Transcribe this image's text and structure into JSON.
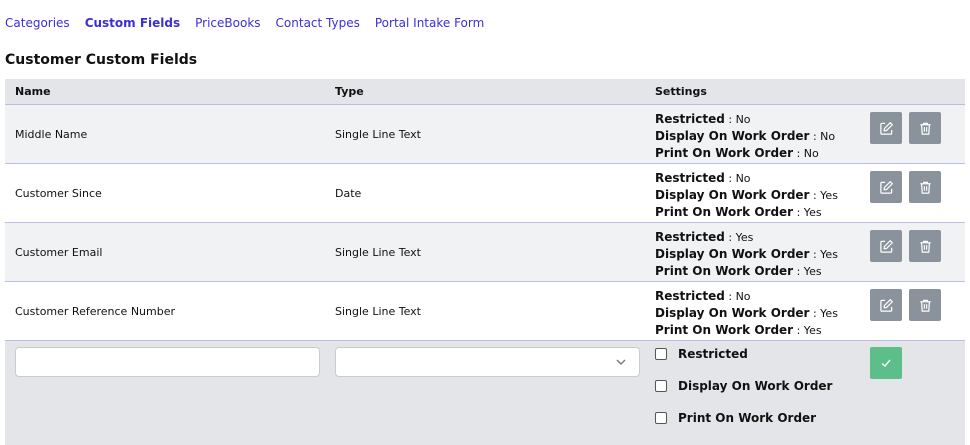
{
  "tabs": [
    {
      "label": "Categories",
      "active": false
    },
    {
      "label": "Custom Fields",
      "active": true
    },
    {
      "label": "PriceBooks",
      "active": false
    },
    {
      "label": "Contact Types",
      "active": false
    },
    {
      "label": "Portal Intake Form",
      "active": false
    }
  ],
  "section_title": "Customer Custom Fields",
  "table": {
    "headers": {
      "name": "Name",
      "type": "Type",
      "settings": "Settings"
    },
    "setting_labels": {
      "restricted": "Restricted",
      "display": "Display On Work Order",
      "print": "Print On Work Order"
    },
    "rows": [
      {
        "name": "Middle Name",
        "type": "Single Line Text",
        "restricted": ": No",
        "display": ": No",
        "print": ": No"
      },
      {
        "name": "Customer Since",
        "type": "Date",
        "restricted": ": No",
        "display": ": Yes",
        "print": ": Yes"
      },
      {
        "name": "Customer Email",
        "type": "Single Line Text",
        "restricted": ": Yes",
        "display": ": Yes",
        "print": ": Yes"
      },
      {
        "name": "Customer Reference Number",
        "type": "Single Line Text",
        "restricted": ": No",
        "display": ": Yes",
        "print": ": Yes"
      }
    ]
  },
  "new_field": {
    "name_value": "",
    "type_value": "",
    "checkboxes": {
      "restricted": "Restricted",
      "display": "Display On Work Order",
      "print": "Print On Work Order"
    }
  },
  "colors": {
    "link": "#3b2fd6",
    "icon_button": "#8a939c",
    "save_button": "#5cbf8a",
    "header_bg": "#e4e5e9"
  },
  "icons": {
    "edit": "edit-icon",
    "delete": "trash-icon",
    "save": "check-icon",
    "select": "chevron-down-icon"
  }
}
